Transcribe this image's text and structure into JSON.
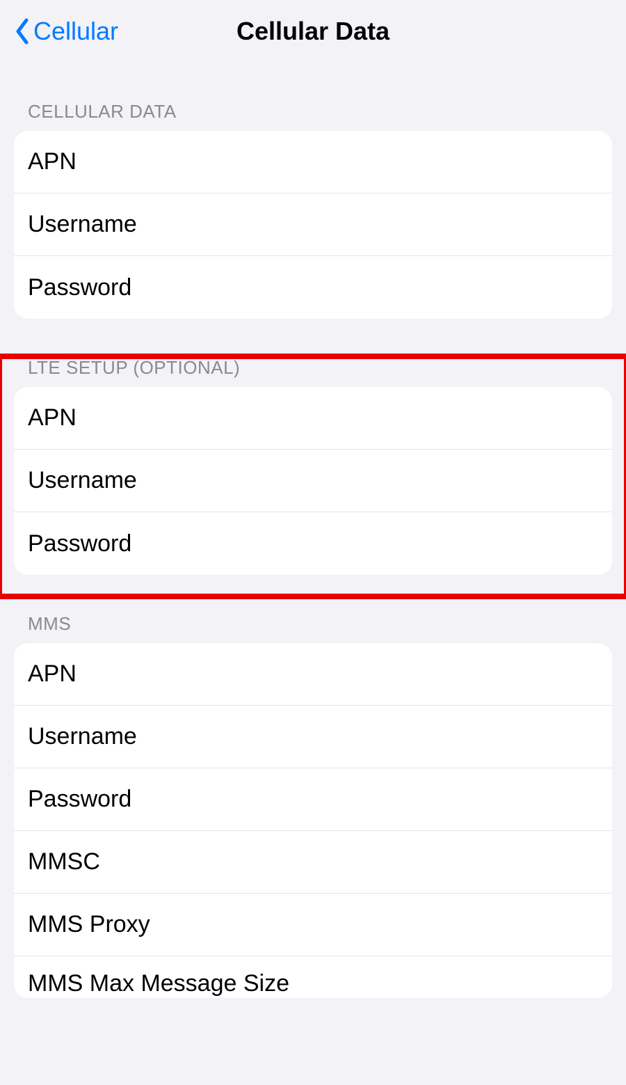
{
  "nav": {
    "back_label": "Cellular",
    "title": "Cellular Data"
  },
  "sections": {
    "cellular_data": {
      "header": "CELLULAR DATA",
      "rows": {
        "apn": "APN",
        "username": "Username",
        "password": "Password"
      }
    },
    "lte_setup": {
      "header": "LTE SETUP (OPTIONAL)",
      "rows": {
        "apn": "APN",
        "username": "Username",
        "password": "Password"
      }
    },
    "mms": {
      "header": "MMS",
      "rows": {
        "apn": "APN",
        "username": "Username",
        "password": "Password",
        "mmsc": "MMSC",
        "mms_proxy": "MMS Proxy",
        "mms_max_message_size": "MMS Max Message Size"
      }
    }
  }
}
